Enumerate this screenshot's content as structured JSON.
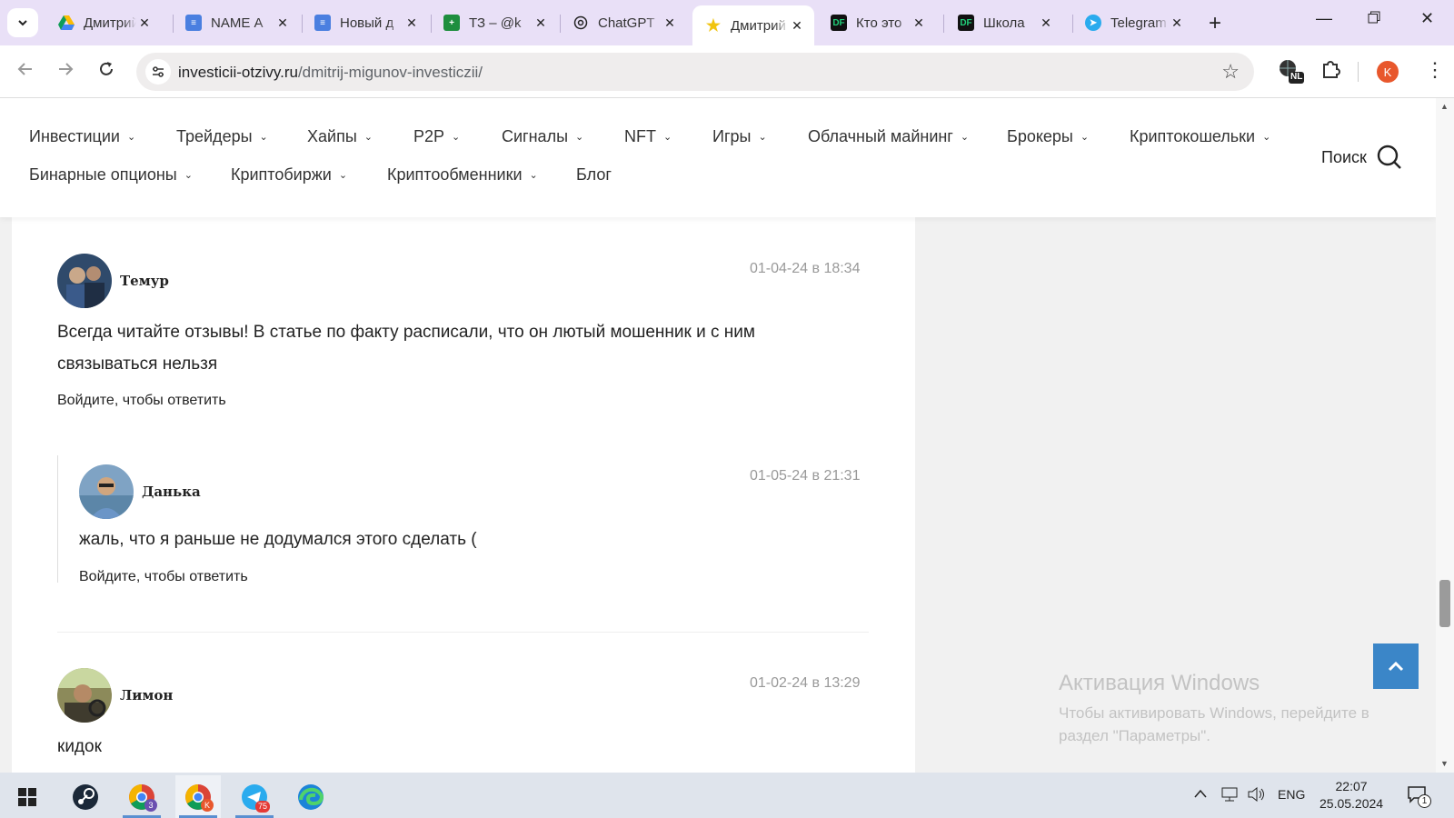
{
  "browser": {
    "tabs": [
      {
        "title": "Дмитрий",
        "favicon": "google-drive-icon"
      },
      {
        "title": "NAME А",
        "favicon": "google-docs-icon"
      },
      {
        "title": "Новый д",
        "favicon": "google-docs-icon"
      },
      {
        "title": "ТЗ – @k",
        "favicon": "google-sheets-icon"
      },
      {
        "title": "ChatGPT",
        "favicon": "chatgpt-icon"
      },
      {
        "title": "Дмитрий",
        "favicon": "star-icon",
        "active": true
      },
      {
        "title": "Кто это",
        "favicon": "df-icon",
        "favicon_text": "DF"
      },
      {
        "title": "Школа",
        "favicon": "df-icon",
        "favicon_text": "DF"
      },
      {
        "title": "Telegram",
        "favicon": "telegram-icon"
      }
    ],
    "url": {
      "domain": "investicii-otzivy.ru",
      "path": "/dmitrij-migunov-investiczii/"
    },
    "profile_initial": "K",
    "extension_badge": "NL"
  },
  "site_nav": {
    "row1": [
      "Инвестиции",
      "Трейдеры",
      "Хайпы",
      "P2P",
      "Сигналы",
      "NFT",
      "Игры",
      "Облачный майнинг",
      "Брокеры",
      "Криптокошельки"
    ],
    "row2": [
      "Бинарные опционы",
      "Криптобиржи",
      "Криптообменники",
      "Блог"
    ],
    "search_label": "Поиск"
  },
  "comments": [
    {
      "author": "Темур",
      "date": "01-04-24 в 18:34",
      "text": "Всегда читайте отзывы! В статье по факту расписали, что он лютый мошенник и с ним связываться нельзя",
      "reply": "Войдите, чтобы ответить"
    },
    {
      "author": "Данька",
      "date": "01-05-24 в 21:31",
      "text": "жаль, что я раньше не додумался этого сделать (",
      "reply": "Войдите, чтобы ответить"
    },
    {
      "author": "Лимон",
      "date": "01-02-24 в 13:29",
      "text": "кидок"
    }
  ],
  "windows_activation": {
    "title": "Активация Windows",
    "subtitle": "Чтобы активировать Windows, перейдите в раздел \"Параметры\"."
  },
  "taskbar": {
    "apps": [
      "windows-start-icon",
      "steam-icon",
      "chrome-icon",
      "chrome-profile-icon",
      "telegram-icon",
      "edge-icon"
    ],
    "chrome_badge": "3",
    "chrome_profile_badge": "K",
    "telegram_badge": "75",
    "language": "ENG",
    "time": "22:07",
    "date": "25.05.2024",
    "notifications": "1"
  }
}
